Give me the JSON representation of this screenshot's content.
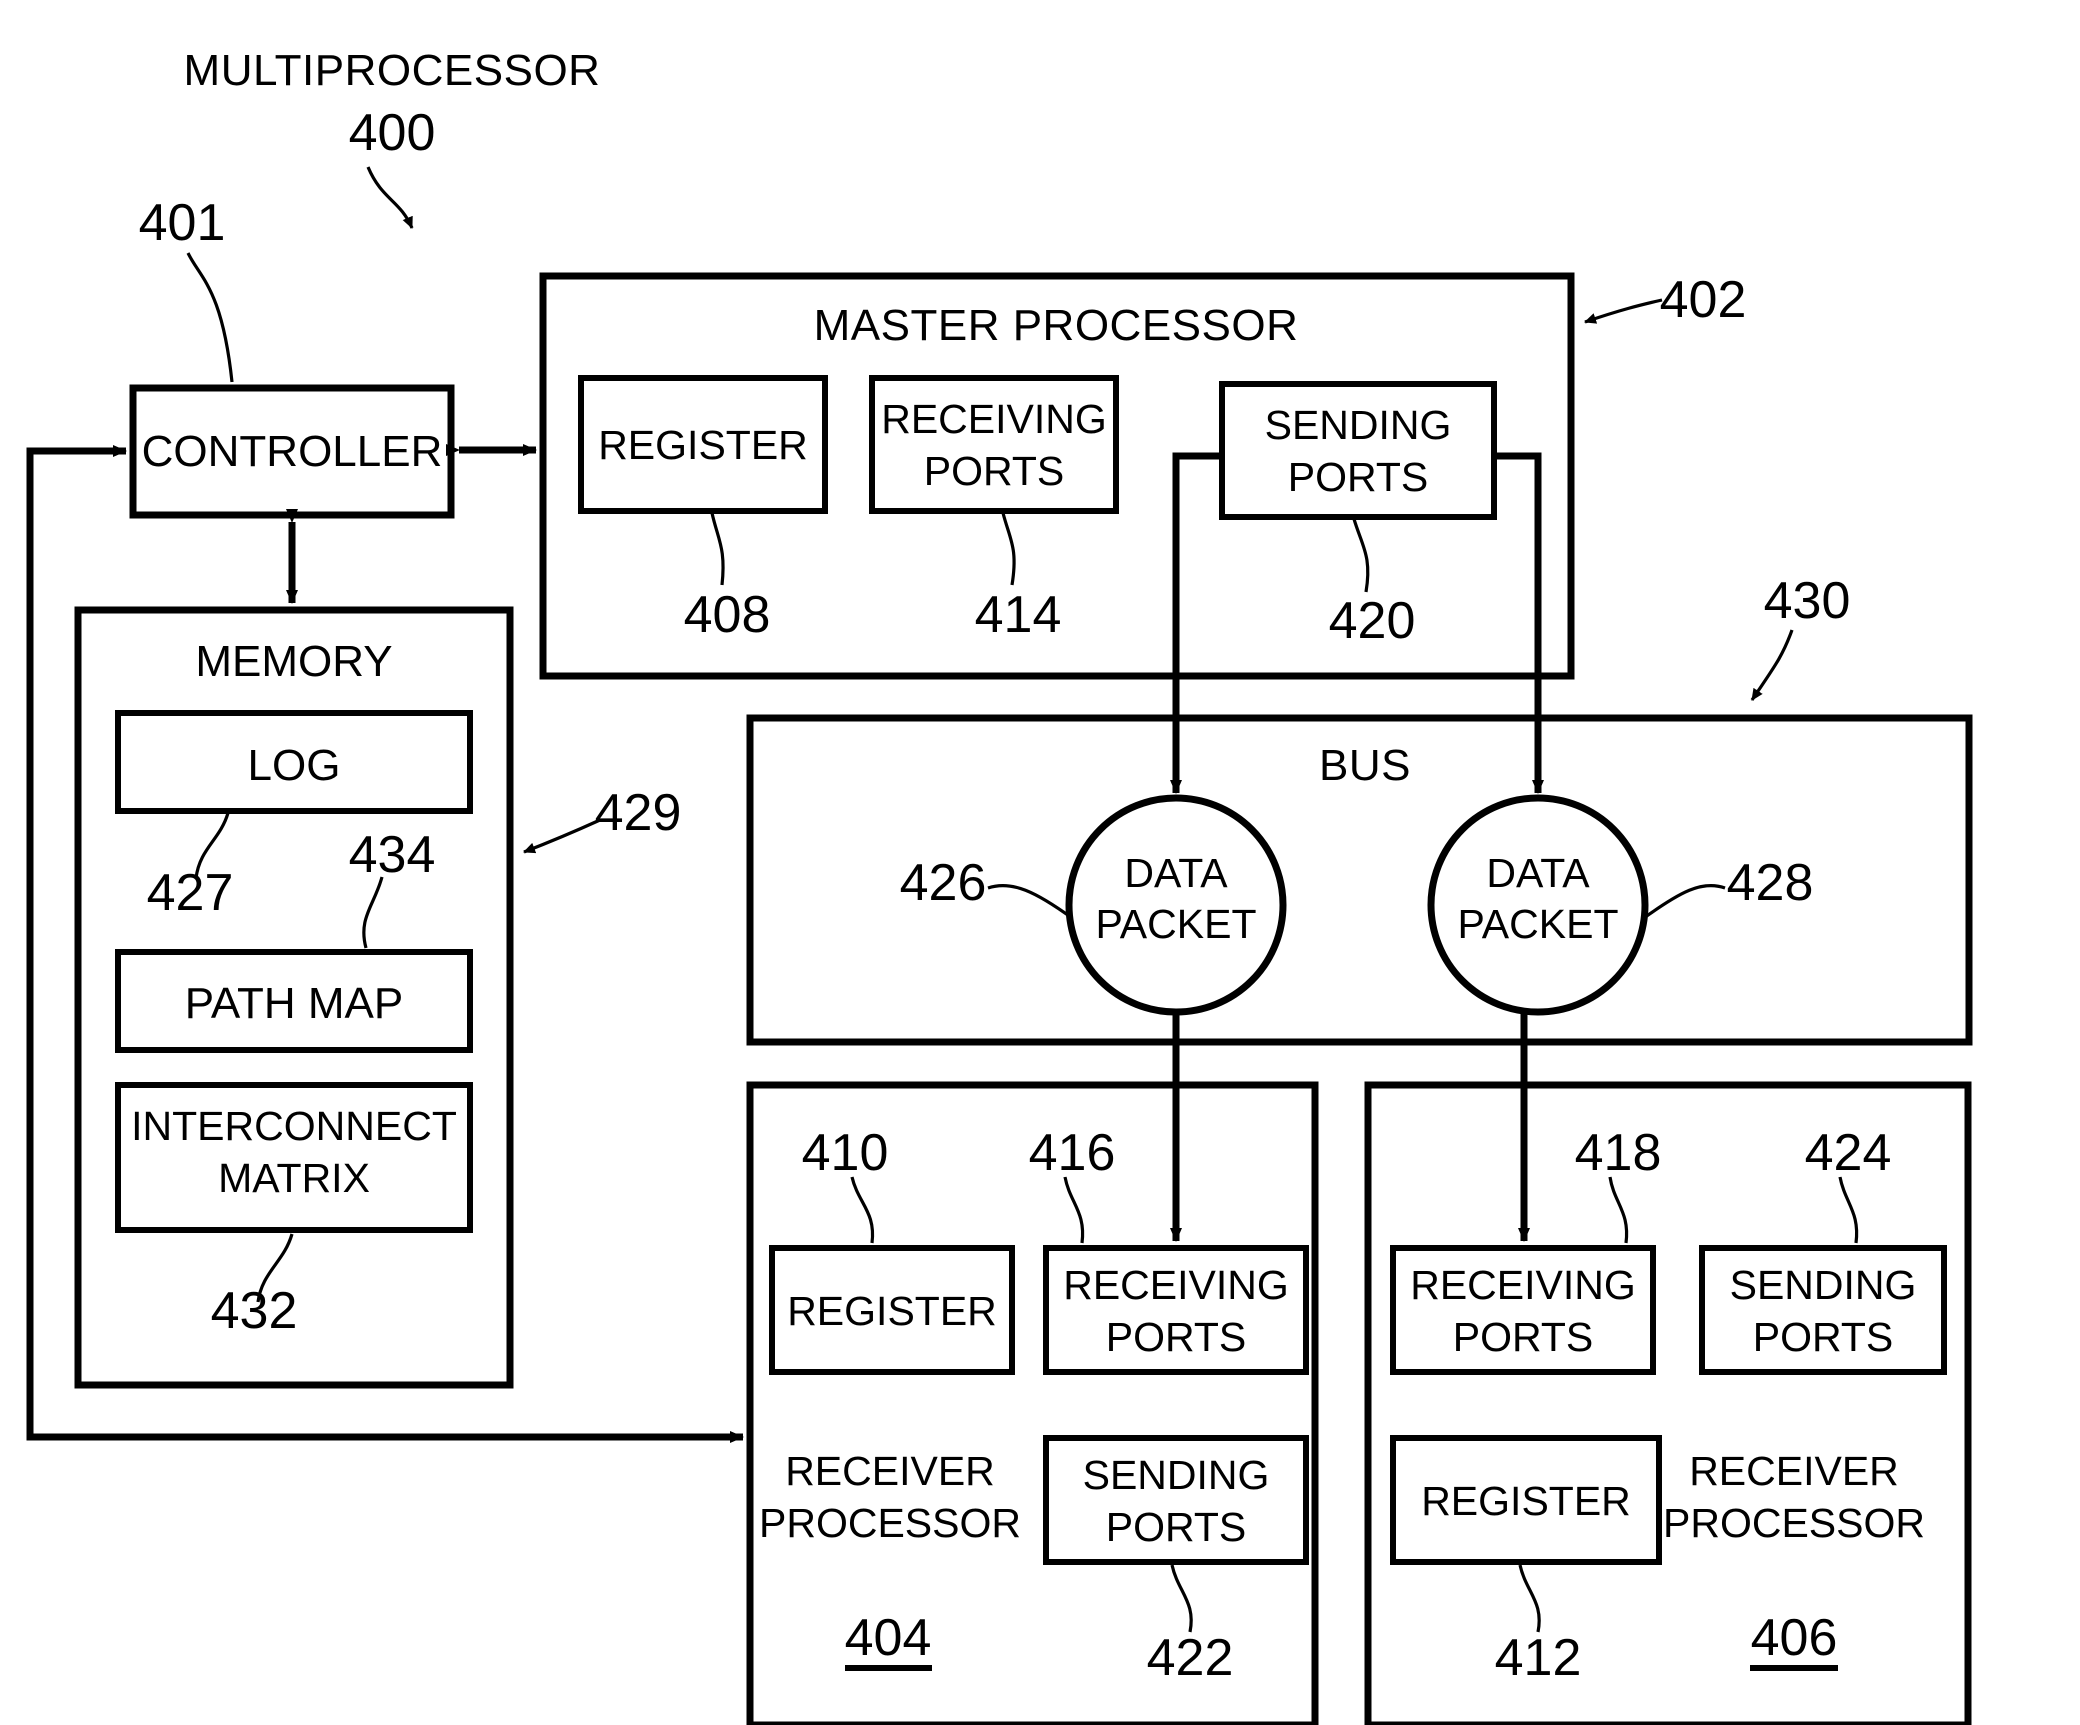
{
  "figure": {
    "title": "MULTIPROCESSOR",
    "title_ref": "400"
  },
  "labels": {
    "controller": "CONTROLLER",
    "controller_ref": "401",
    "memory": "MEMORY",
    "memory_ref": "429",
    "log": "LOG",
    "log_ref": "427",
    "path_map": "PATH MAP",
    "path_map_ref": "434",
    "interconnect_matrix_line1": "INTERCONNECT",
    "interconnect_matrix_line2": "MATRIX",
    "interconnect_matrix_ref": "432",
    "master_processor": "MASTER PROCESSOR",
    "master_processor_ref": "402",
    "master_register": "REGISTER",
    "master_register_ref": "408",
    "master_receiving_line1": "RECEIVING",
    "master_receiving_line2": "PORTS",
    "master_receiving_ref": "414",
    "master_sending_line1": "SENDING",
    "master_sending_line2": "PORTS",
    "master_sending_ref": "420",
    "bus": "BUS",
    "bus_ref": "430",
    "data_packet_line1": "DATA",
    "data_packet_line2": "PACKET",
    "data_packet_left_ref": "426",
    "data_packet_right_ref": "428",
    "receiver_a_line1": "RECEIVER",
    "receiver_a_line2": "PROCESSOR",
    "receiver_a_ref": "404",
    "receiver_a_register": "REGISTER",
    "receiver_a_register_ref": "410",
    "receiver_a_receiving_line1": "RECEIVING",
    "receiver_a_receiving_line2": "PORTS",
    "receiver_a_receiving_ref": "416",
    "receiver_a_sending_line1": "SENDING",
    "receiver_a_sending_line2": "PORTS",
    "receiver_a_sending_ref": "422",
    "receiver_b_line1": "RECEIVER",
    "receiver_b_line2": "PROCESSOR",
    "receiver_b_ref": "406",
    "receiver_b_register": "REGISTER",
    "receiver_b_register_ref": "412",
    "receiver_b_receiving_line1": "RECEIVING",
    "receiver_b_receiving_line2": "PORTS",
    "receiver_b_receiving_ref": "418",
    "receiver_b_sending_line1": "SENDING",
    "receiver_b_sending_line2": "PORTS",
    "receiver_b_sending_ref": "424"
  },
  "style": {
    "ink": "#000000",
    "paper": "#ffffff"
  }
}
